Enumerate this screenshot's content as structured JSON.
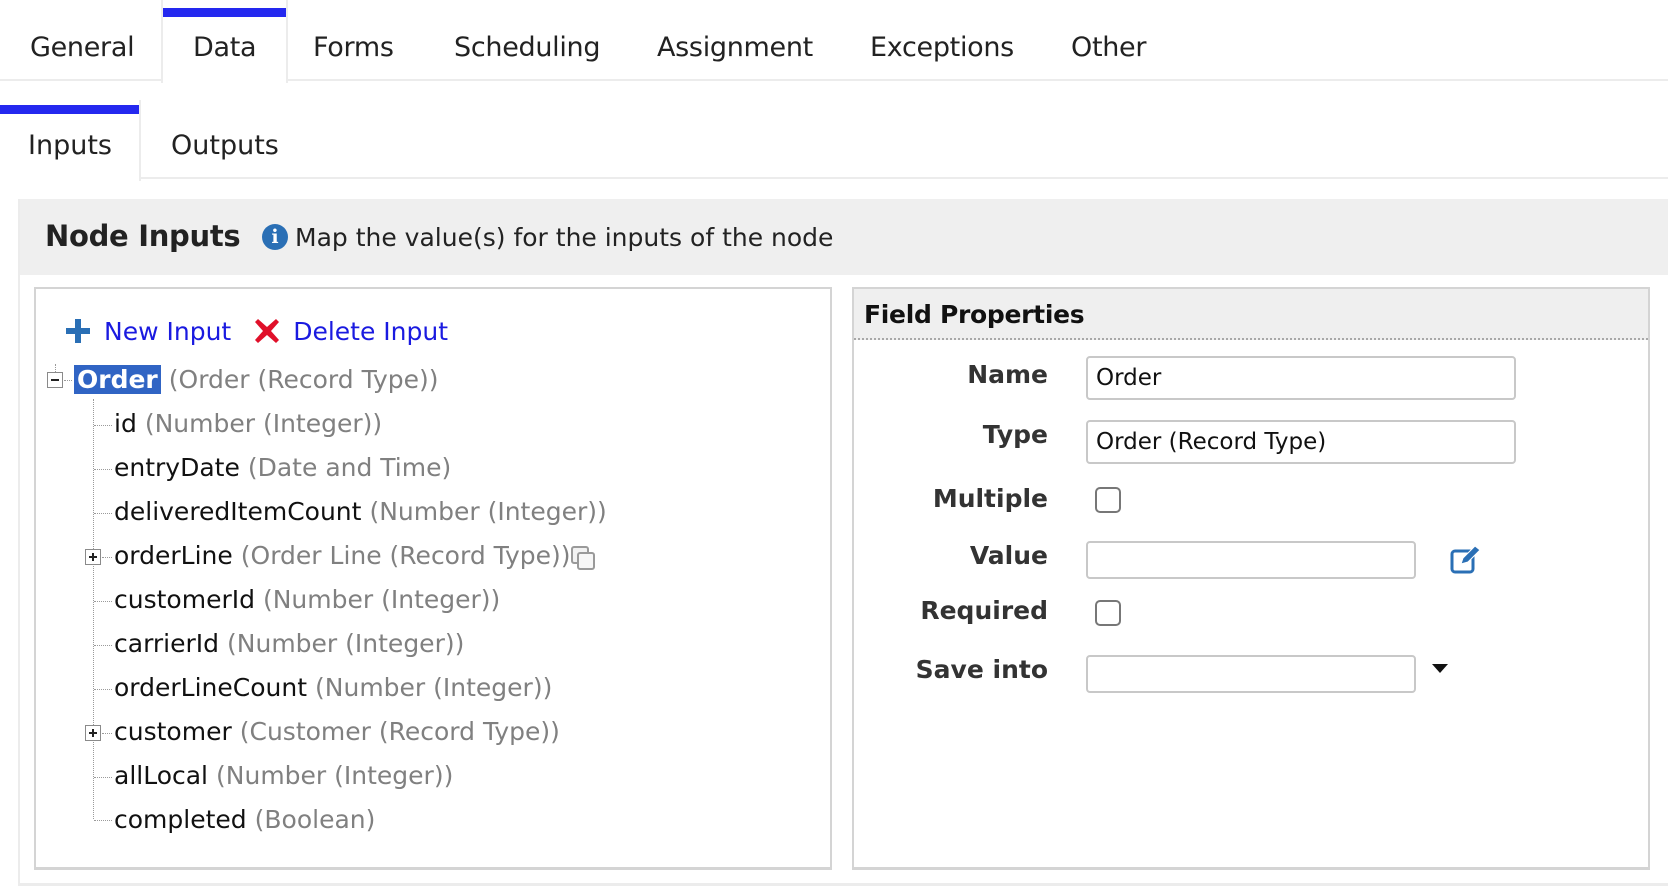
{
  "tabs": [
    {
      "label": "General",
      "active": false
    },
    {
      "label": "Data",
      "active": true
    },
    {
      "label": "Forms",
      "active": false
    },
    {
      "label": "Scheduling",
      "active": false
    },
    {
      "label": "Assignment",
      "active": false
    },
    {
      "label": "Exceptions",
      "active": false
    },
    {
      "label": "Other",
      "active": false
    }
  ],
  "subtabs": [
    {
      "label": "Inputs",
      "active": true
    },
    {
      "label": "Outputs",
      "active": false
    }
  ],
  "section": {
    "title": "Node Inputs",
    "info_icon": "info-icon",
    "info_text": "Map the value(s) for the inputs of the node"
  },
  "toolbar": {
    "new_input_label": "New Input",
    "new_input_icon": "plus-icon",
    "delete_input_label": "Delete Input",
    "delete_input_icon": "x-icon"
  },
  "tree": {
    "root": {
      "name": "Order",
      "type": "(Order (Record Type))",
      "expanded": true,
      "selected": true
    },
    "children": [
      {
        "name": "id",
        "type": "(Number (Integer))",
        "expandable": false
      },
      {
        "name": "entryDate",
        "type": "(Date and Time)",
        "expandable": false
      },
      {
        "name": "deliveredItemCount",
        "type": "(Number (Integer))",
        "expandable": false
      },
      {
        "name": "orderLine",
        "type": "(Order Line (Record Type))",
        "expandable": true,
        "has_copy_icon": true
      },
      {
        "name": "customerId",
        "type": "(Number (Integer))",
        "expandable": false
      },
      {
        "name": "carrierId",
        "type": "(Number (Integer))",
        "expandable": false
      },
      {
        "name": "orderLineCount",
        "type": "(Number (Integer))",
        "expandable": false
      },
      {
        "name": "customer",
        "type": "(Customer (Record Type))",
        "expandable": true
      },
      {
        "name": "allLocal",
        "type": "(Number (Integer))",
        "expandable": false
      },
      {
        "name": "completed",
        "type": "(Boolean)",
        "expandable": false
      }
    ]
  },
  "field_properties": {
    "title": "Field Properties",
    "name_label": "Name",
    "name_value": "Order",
    "type_label": "Type",
    "type_value": "Order (Record Type)",
    "multiple_label": "Multiple",
    "multiple_checked": false,
    "value_label": "Value",
    "value_value": "",
    "required_label": "Required",
    "required_checked": false,
    "save_into_label": "Save into",
    "save_into_value": ""
  },
  "colors": {
    "active_tab_indicator": "#2428ef",
    "link": "#1a1ae0",
    "selection": "#3064c4",
    "info_icon": "#2a6fb5",
    "delete_icon": "#e0102a"
  }
}
